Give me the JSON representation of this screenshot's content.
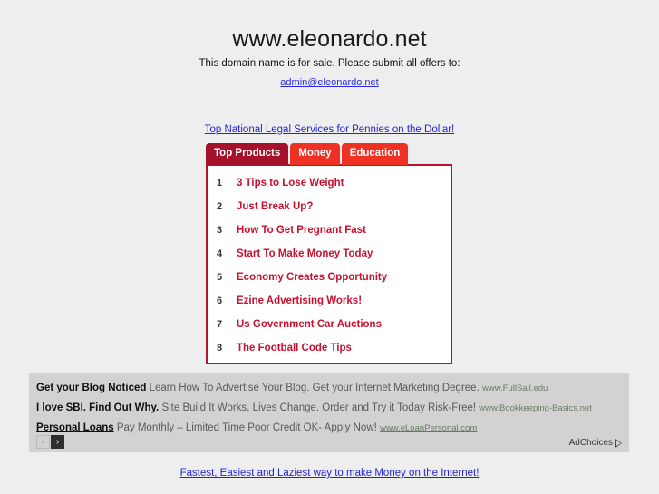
{
  "header": {
    "domain": "www.eleonardo.net",
    "subtitle": "This domain name is for sale. Please submit all offers to:",
    "email": "admin@eleonardo.net"
  },
  "top_sponsored_link": "Top National Legal Services for Pennies on the Dollar!",
  "tabs": [
    {
      "label": "Top Products",
      "active": true
    },
    {
      "label": "Money",
      "active": false
    },
    {
      "label": "Education",
      "active": false
    }
  ],
  "products": [
    {
      "num": "1",
      "title": "3 Tips to Lose Weight"
    },
    {
      "num": "2",
      "title": "Just Break Up?"
    },
    {
      "num": "3",
      "title": "How To Get Pregnant Fast"
    },
    {
      "num": "4",
      "title": "Start To Make Money Today"
    },
    {
      "num": "5",
      "title": "Economy Creates Opportunity"
    },
    {
      "num": "6",
      "title": "Ezine Advertising Works!"
    },
    {
      "num": "7",
      "title": "Us Government Car Auctions"
    },
    {
      "num": "8",
      "title": "The Football Code Tips"
    }
  ],
  "ads": [
    {
      "headline": "Get your Blog Noticed",
      "body": "Learn How To Advertise Your Blog. Get your Internet Marketing Degree.",
      "url": "www.FullSail.edu"
    },
    {
      "headline": "I love SBI. Find Out Why.",
      "body": "Site Build It Works. Lives Change. Order and Try it Today Risk-Free!",
      "url": "www.Bookkeeping-Basics.net"
    },
    {
      "headline": "Personal Loans",
      "body": "Pay Monthly – Limited Time Poor Credit OK- Apply Now!",
      "url": "www.eLoanPersonal.com"
    }
  ],
  "ad_nav": {
    "prev": "‹",
    "next": "›"
  },
  "adchoices_label": "AdChoices",
  "bottom_link": "Fastest, Easiest and Laziest way to make Money on the Internet!",
  "colors": {
    "page_background": "#eeeeee",
    "tab_active": "#a5102a",
    "tab_inactive": "#ef3124",
    "panel_border": "#b51230",
    "product_title": "#c8102e",
    "link_blue": "#2222dd",
    "ad_background": "#d2d2d2",
    "ad_url": "#6a7a62"
  }
}
